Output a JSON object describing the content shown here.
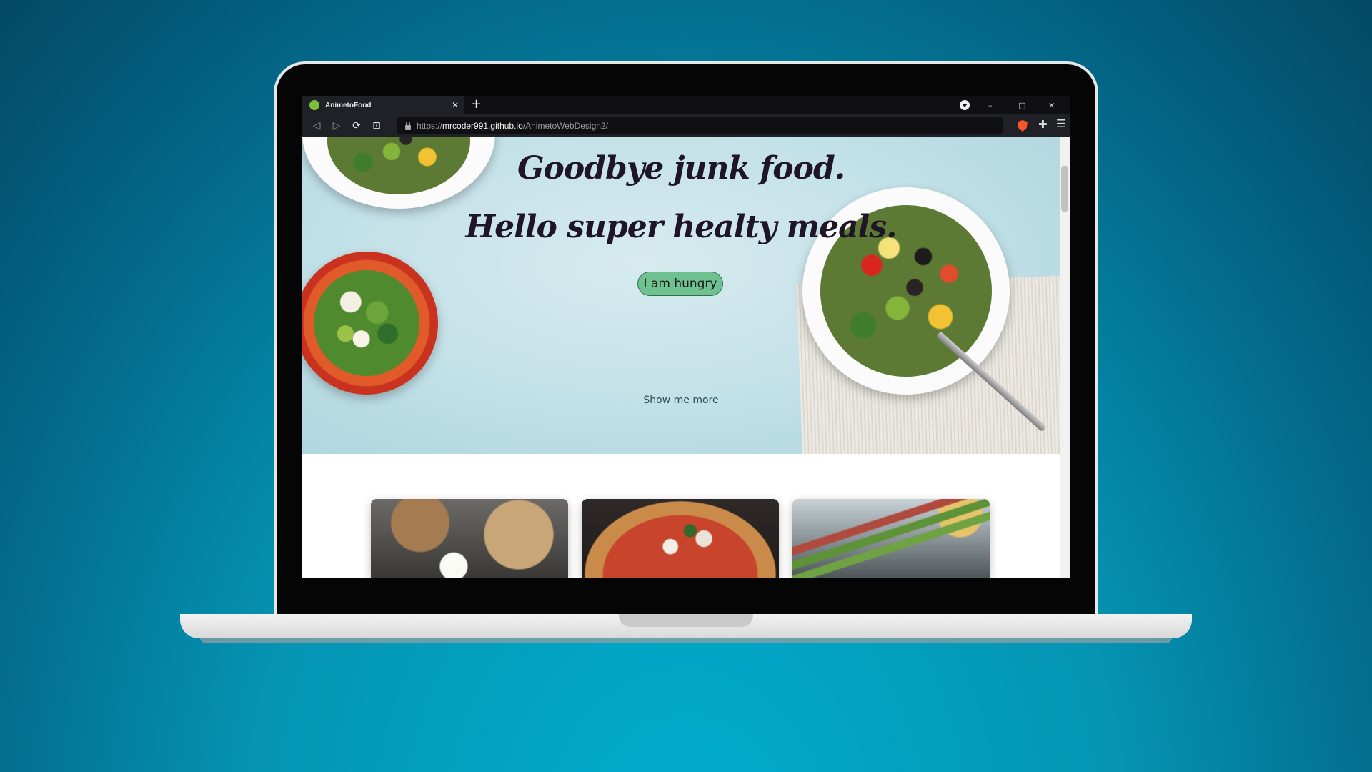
{
  "browser": {
    "tab_title": "AnimetoFood",
    "tab_close": "✕",
    "new_tab": "+",
    "url": {
      "scheme": "https://",
      "host": "mrcoder991.github.io",
      "path": "/AnimetoWebDesign2/"
    },
    "window_controls": [
      "–",
      "□",
      "✕"
    ],
    "icons": [
      "back-icon",
      "forward-icon",
      "reload-icon",
      "bookmark-icon",
      "lock-icon",
      "brave-shield-icon",
      "extensions-icon",
      "menu-icon"
    ]
  },
  "hero": {
    "line1": "Goodbye junk food.",
    "line2": "Hello super healty meals.",
    "cta_label": "I am hungry",
    "more_link": "Show me more"
  },
  "cards": [
    {
      "image": "asian-breakfast-photo"
    },
    {
      "image": "pizza-photo"
    },
    {
      "image": "asparagus-photo"
    }
  ],
  "colors": {
    "cta_bg": "#6fc290",
    "headline": "#1e1526",
    "background": "#0594b3"
  }
}
